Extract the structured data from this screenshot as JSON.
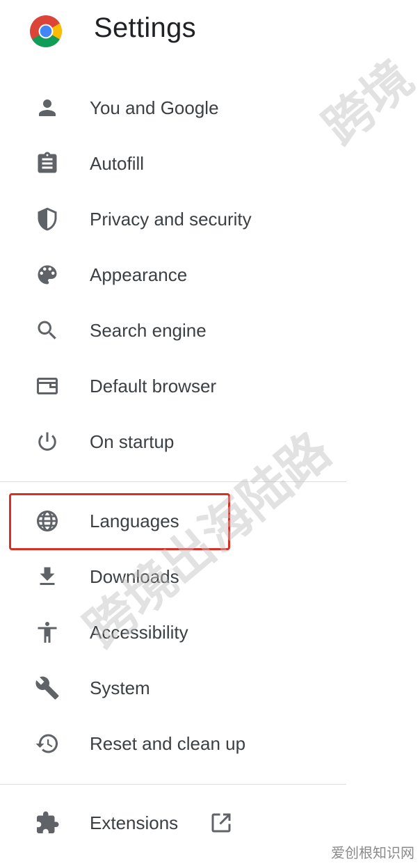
{
  "header": {
    "title": "Settings"
  },
  "menu": [
    {
      "label": "You and Google",
      "icon": "person-icon"
    },
    {
      "label": "Autofill",
      "icon": "clipboard-icon"
    },
    {
      "label": "Privacy and security",
      "icon": "shield-icon"
    },
    {
      "label": "Appearance",
      "icon": "palette-icon"
    },
    {
      "label": "Search engine",
      "icon": "search-icon"
    },
    {
      "label": "Default browser",
      "icon": "browser-window-icon"
    },
    {
      "label": "On startup",
      "icon": "power-icon"
    },
    {
      "label": "Languages",
      "icon": "globe-icon"
    },
    {
      "label": "Downloads",
      "icon": "download-icon"
    },
    {
      "label": "Accessibility",
      "icon": "accessibility-icon"
    },
    {
      "label": "System",
      "icon": "wrench-icon"
    },
    {
      "label": "Reset and clean up",
      "icon": "history-icon"
    },
    {
      "label": "Extensions",
      "icon": "puzzle-icon"
    }
  ],
  "colors": {
    "icon": "#5f6368",
    "text": "#3c4043",
    "highlight_border": "#d93025",
    "divider": "#dadce0"
  },
  "watermark": {
    "text1": "跨境",
    "text2": "跨境出海陆路",
    "footer": "爱创根知识网"
  }
}
